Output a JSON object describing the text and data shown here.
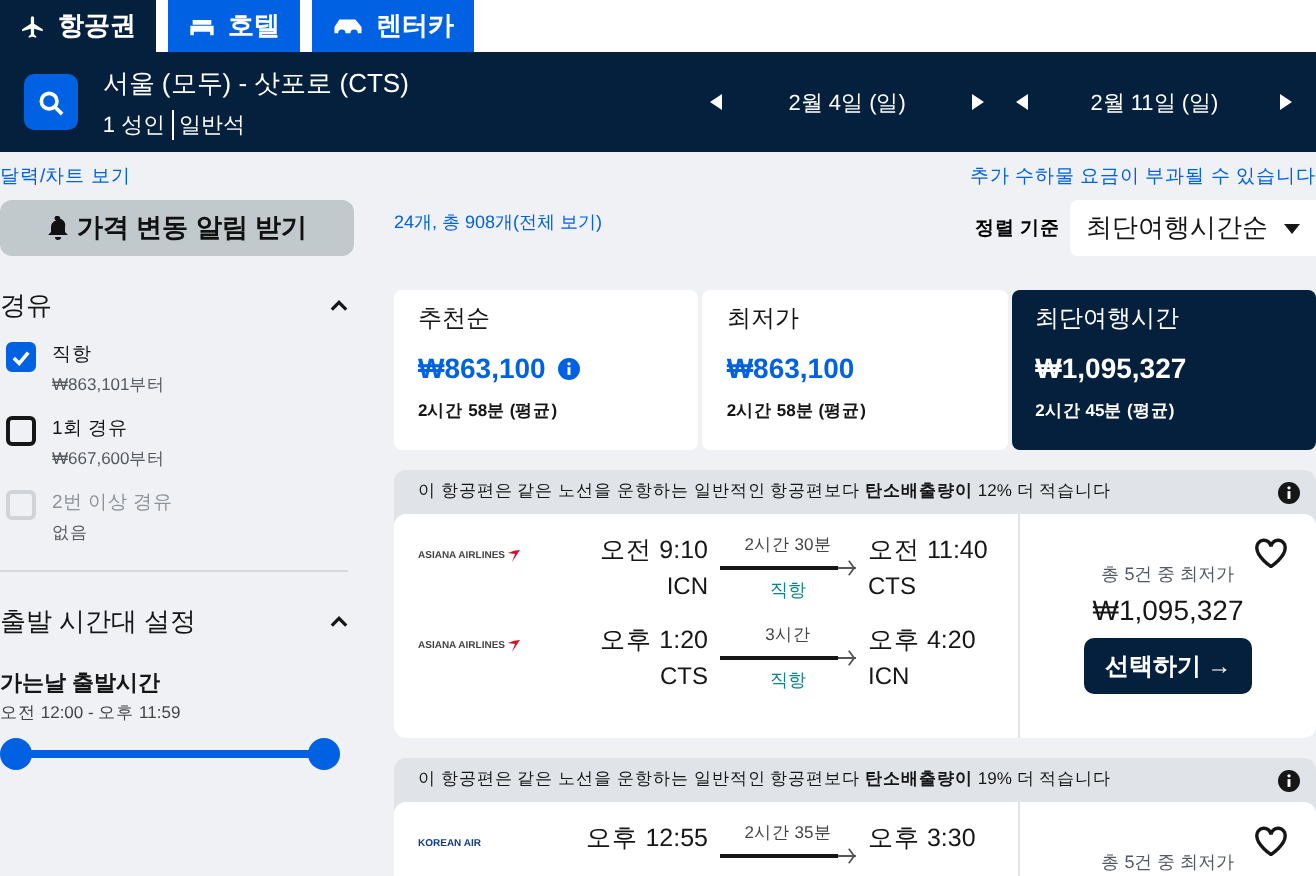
{
  "top_tabs": [
    {
      "label": "항공권",
      "selected": true
    },
    {
      "label": "호텔",
      "selected": false
    },
    {
      "label": "렌터카",
      "selected": false
    }
  ],
  "search": {
    "route": "서울 (모두) - 삿포로 (CTS)",
    "passengers": "1 성인",
    "cabin": "일반석",
    "dates": [
      "2월 4일 (일)",
      "2월 11일 (일)"
    ]
  },
  "links": {
    "calendar": "달력/차트 보기",
    "baggage": "추가 수하물 요금이 부과될 수 있습니다"
  },
  "alert_button": "가격 변동 알림 받기",
  "result_count": "24개, 총 908개(전체 보기)",
  "sort": {
    "label": "정렬 기준",
    "value": "최단여행시간순"
  },
  "filters": {
    "stops": {
      "title": "경유",
      "expanded": true,
      "options": [
        {
          "label": "직항",
          "sub": "₩863,101부터",
          "checked": true,
          "disabled": false
        },
        {
          "label": "1회 경유",
          "sub": "₩667,600부터",
          "checked": false,
          "disabled": false
        },
        {
          "label": "2번 이상 경유",
          "sub": "없음",
          "checked": false,
          "disabled": true
        }
      ]
    },
    "departure": {
      "title": "출발 시간대 설정",
      "expanded": true,
      "label": "가는날 출발시간",
      "range": "오전 12:00 - 오후 11:59",
      "level": 1
    }
  },
  "sort_tabs": [
    {
      "label": "추천순",
      "price": "₩863,100",
      "duration": "2시간 58분 (평균)",
      "info": true,
      "selected": false
    },
    {
      "label": "최저가",
      "price": "₩863,100",
      "duration": "2시간 58분 (평균)",
      "info": false,
      "selected": false
    },
    {
      "label": "최단여행시간",
      "price": "₩1,095,327",
      "duration": "2시간 45분 (평균)",
      "info": false,
      "selected": true
    }
  ],
  "results": [
    {
      "eco_note": "이 항공편은 같은 노선을 운항하는 일반적인 항공편보다 **탄소배출량이** 12% 더 적습니다",
      "favorite": false,
      "legs": [
        {
          "airline": "ASIANA AIRLINES",
          "depart": "오전 9:10",
          "from": "ICN",
          "duration": "2시간 30분",
          "stops": "직항",
          "arrive": "오전 11:40",
          "to": "CTS"
        },
        {
          "airline": "ASIANA AIRLINES",
          "depart": "오후 1:20",
          "from": "CTS",
          "duration": "3시간",
          "stops": "직항",
          "arrive": "오후 4:20",
          "to": "ICN"
        }
      ],
      "price_label": "총 5건 중 최저가",
      "price": "₩1,095,327",
      "select": "선택하기 →"
    },
    {
      "eco_note": "이 항공편은 같은 노선을 운항하는 일반적인 항공편보다 **탄소배출량이** 19% 더 적습니다",
      "favorite": false,
      "legs": [
        {
          "airline": "KOREAN AIR",
          "depart": "오후 12:55",
          "duration": "2시간 35분",
          "arrive": "오후 3:30"
        }
      ],
      "price_label": "총 5건 중 최저가"
    }
  ]
}
